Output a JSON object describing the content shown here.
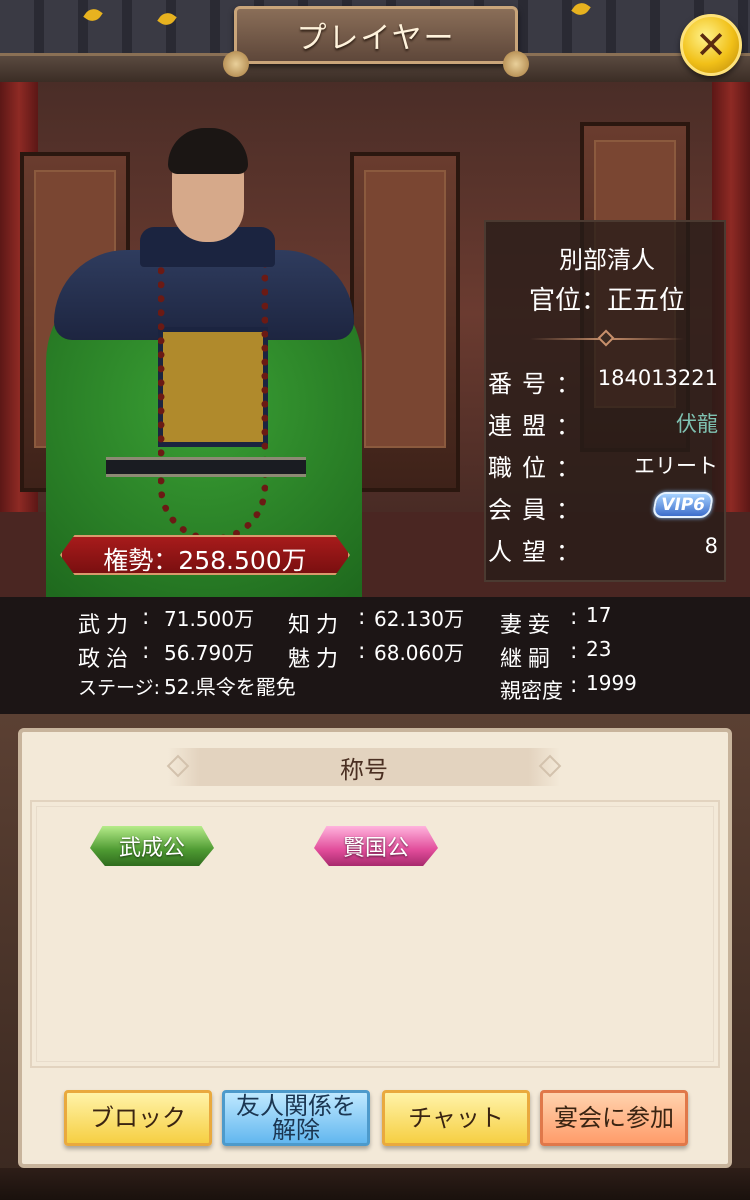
{
  "header": {
    "title": "プレイヤー",
    "close_icon": "close-icon"
  },
  "player": {
    "name": "別部清人",
    "rank": "官位：正五位",
    "power": "権勢：258.500万",
    "info": [
      {
        "label": "番号：",
        "value": "184013221"
      },
      {
        "label": "連盟：",
        "value": "伏龍"
      },
      {
        "label": "職位：",
        "value": "エリート"
      },
      {
        "label": "会員：",
        "value": "VIP6"
      },
      {
        "label": "人望：",
        "value": "8"
      }
    ]
  },
  "stats": {
    "force_label": "武力",
    "force_value": "71.500万",
    "intel_label": "知力",
    "intel_value": "62.130万",
    "wives_label": "妻妾",
    "wives_value": "17",
    "politics_label": "政治",
    "politics_value": "56.790万",
    "charm_label": "魅力",
    "charm_value": "68.060万",
    "heirs_label": "継嗣",
    "heirs_value": "23",
    "stage_label": "ステージ:",
    "stage_value": "52.県令を罷免",
    "intimacy_label": "親密度",
    "intimacy_value": "1999"
  },
  "titles_section": {
    "header": "称号",
    "titles": [
      "武成公",
      "賢国公"
    ]
  },
  "actions": {
    "block": "ブロック",
    "unfriend_line1": "友人関係を",
    "unfriend_line2": "解除",
    "chat": "チャット",
    "banquet": "宴会に参加"
  },
  "colors": {
    "power_banner": "#a71b1b",
    "alliance_text": "#7fc1b1",
    "panel_bg": "#f3e9d8"
  }
}
